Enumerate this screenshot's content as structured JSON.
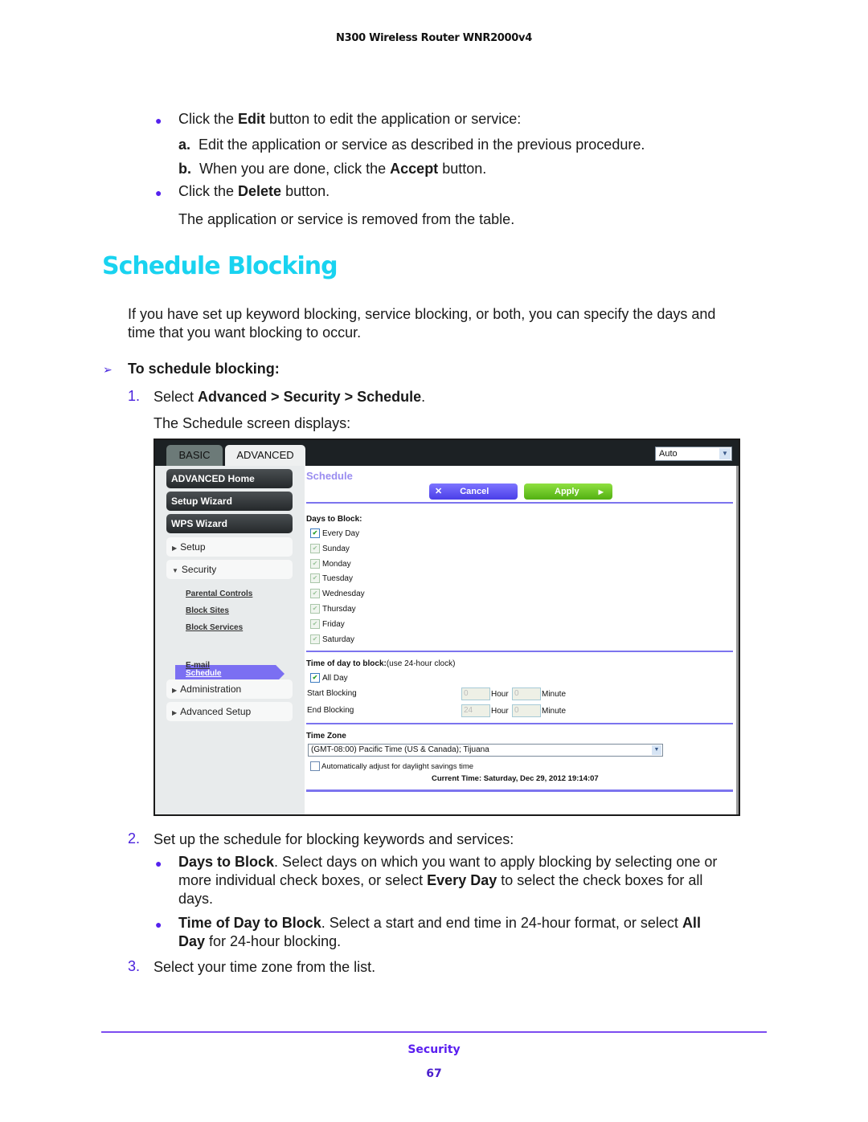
{
  "header": {
    "running_title": "N300 Wireless Router WNR2000v4"
  },
  "intro": {
    "bullet1": {
      "pre": "Click the ",
      "bold": "Edit",
      "post": " button to edit the application or service:"
    },
    "sub_a": {
      "marker": "a.",
      "text": "Edit the application or service as described in the previous procedure."
    },
    "sub_b": {
      "marker": "b.",
      "pre": "When you are done, click the ",
      "bold": "Accept",
      "post": " button."
    },
    "bullet2": {
      "pre": "Click the ",
      "bold": "Delete",
      "post": " button."
    },
    "result": "The application or service is removed from the table."
  },
  "section": {
    "title": "Schedule Blocking",
    "para_line1": "If you have set up keyword blocking, service blocking, or both, you can specify the days and",
    "para_line2": "time that you want blocking to occur.",
    "procedure_heading": "To schedule blocking:",
    "step1": {
      "num": "1.",
      "pre": "Select ",
      "path": "Advanced > Security > Schedule",
      "post": "."
    },
    "step1_result": "The Schedule screen displays:",
    "step2": {
      "num": "2.",
      "text": "Set up the schedule for blocking keywords and services:"
    },
    "step2_b1": {
      "bold": "Days to Block",
      "line1": ". Select days on which you want to apply blocking by selecting one or",
      "line2_pre": "more individual check boxes, or select ",
      "line2_bold": "Every Day",
      "line2_post": " to select the check boxes for all",
      "line3": "days."
    },
    "step2_b2": {
      "bold": "Time of Day to Block",
      "line1": ". Select a start and end time in 24-hour format, or select ",
      "line1_bold": "All",
      "line2_bold": "Day",
      "line2_post": " for 24-hour blocking."
    },
    "step3": {
      "num": "3.",
      "text": "Select your time zone from the list."
    }
  },
  "router_ui": {
    "tabs": [
      {
        "label": "BASIC"
      },
      {
        "label": "ADVANCED",
        "active": true
      }
    ],
    "language": "Auto",
    "sidebar": {
      "dark_items": [
        "ADVANCED Home",
        "Setup Wizard",
        "WPS Wizard"
      ],
      "sections": [
        {
          "label": "Setup",
          "expanded": false
        },
        {
          "label": "Security",
          "expanded": true
        },
        {
          "label": "Administration",
          "expanded": false
        },
        {
          "label": "Advanced Setup",
          "expanded": false
        }
      ],
      "security_links": [
        "Parental Controls",
        "Block Sites",
        "Block Services",
        "Schedule",
        "E-mail"
      ],
      "active_link": "Schedule"
    },
    "page_title": "Schedule",
    "buttons": {
      "cancel": "Cancel",
      "apply": "Apply"
    },
    "days_label": "Days to Block:",
    "days": [
      {
        "label": "Every Day",
        "checked": true
      },
      {
        "label": "Sunday",
        "checked": true,
        "disabled": true
      },
      {
        "label": "Monday",
        "checked": true,
        "disabled": true
      },
      {
        "label": "Tuesday",
        "checked": true,
        "disabled": true
      },
      {
        "label": "Wednesday",
        "checked": true,
        "disabled": true
      },
      {
        "label": "Thursday",
        "checked": true,
        "disabled": true
      },
      {
        "label": "Friday",
        "checked": true,
        "disabled": true
      },
      {
        "label": "Saturday",
        "checked": true,
        "disabled": true
      }
    ],
    "time_label_bold": "Time of day to block:",
    "time_label_note": "(use 24-hour clock)",
    "all_day": {
      "label": "All Day",
      "checked": true
    },
    "start": {
      "label": "Start Blocking",
      "hour": "0",
      "minute": "0"
    },
    "end": {
      "label": "End Blocking",
      "hour": "24",
      "minute": "0"
    },
    "hour_label": "Hour",
    "minute_label": "Minute",
    "timezone_label": "Time Zone",
    "timezone_value": "(GMT-08:00) Pacific Time (US & Canada); Tijuana",
    "dst": {
      "label": "Automatically adjust for daylight savings time",
      "checked": false
    },
    "current_time_label": "Current Time:",
    "current_time_value": "Saturday, Dec 29, 2012 19:14:07"
  },
  "footer": {
    "section": "Security",
    "page": "67"
  },
  "colors": {
    "title_cyan": "#19d3f0",
    "accent_purple": "#5a1ef0",
    "router_active": "#7b6ff2",
    "apply_green": "#52b012",
    "cancel_blue": "#4a3ee8"
  }
}
